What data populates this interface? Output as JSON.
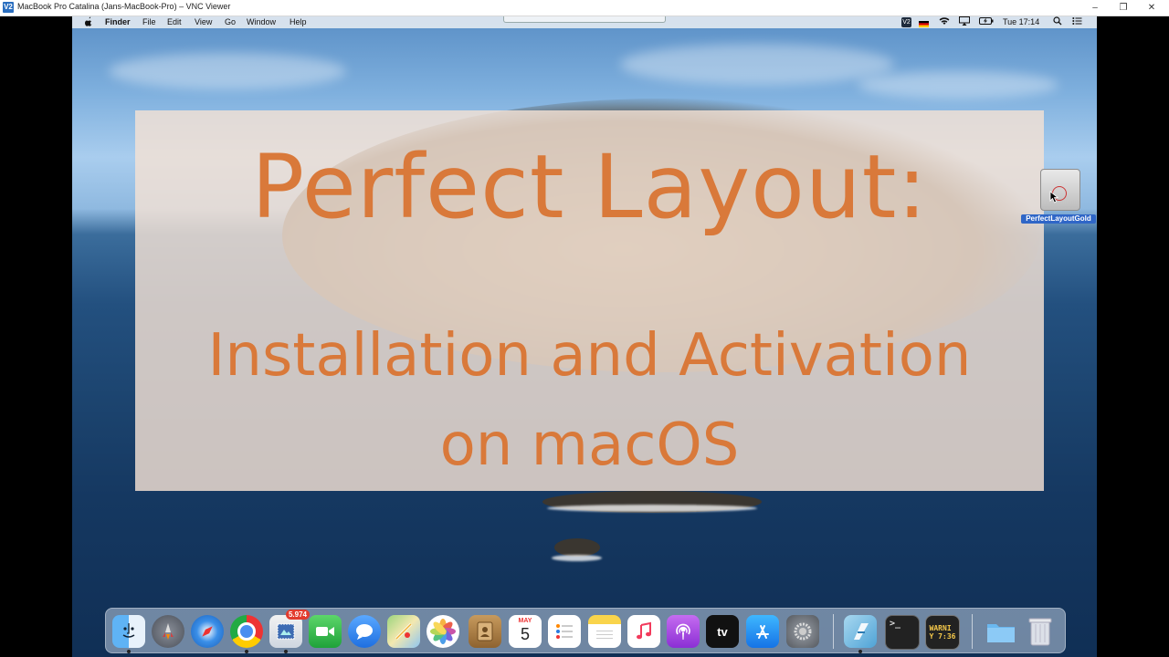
{
  "window": {
    "icon": "V2",
    "title": "MacBook Pro Catalina (Jans-MacBook-Pro) – VNC Viewer",
    "controls": [
      "–",
      "❐",
      "✕"
    ]
  },
  "menubar": {
    "apple": "",
    "app_name": "Finder",
    "items": [
      "File",
      "Edit",
      "View",
      "Go",
      "Window",
      "Help"
    ],
    "status": {
      "vnc": "V2",
      "clock": "Tue 17:14"
    }
  },
  "overlay": {
    "title": "Perfect Layout:",
    "subtitle_line1": "Installation and Activation",
    "subtitle_line2": "on macOS"
  },
  "desktop": {
    "drive_label": "PerfectLayoutGold"
  },
  "dock": {
    "mail_badge": "5.974",
    "calendar_month": "MAY",
    "calendar_day": "5",
    "tv_label": "tv",
    "console_text": "WARNI\nY 7:36",
    "terminal_text": ">_"
  }
}
